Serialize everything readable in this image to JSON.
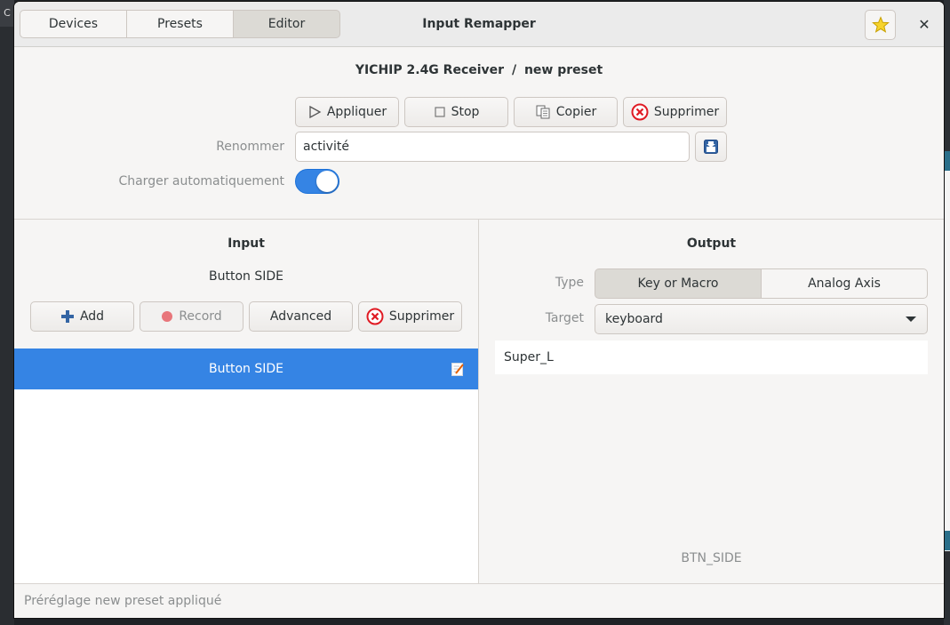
{
  "header": {
    "title": "Input Remapper",
    "views": [
      "Devices",
      "Presets",
      "Editor"
    ],
    "active_view": "Editor",
    "star_icon": "star-icon",
    "close_label": "✕"
  },
  "editor": {
    "device_name": "YICHIP 2.4G Receiver",
    "separator": "/",
    "preset_name": "new preset",
    "buttons": {
      "apply": "Appliquer",
      "stop": "Stop",
      "copy": "Copier",
      "delete": "Supprimer"
    },
    "rename_label": "Renommer",
    "rename_value": "activité",
    "autoload_label": "Charger automatiquement",
    "autoload_on": true
  },
  "input_pane": {
    "heading": "Input",
    "selected_input": "Button SIDE",
    "buttons": {
      "add": "Add",
      "record": "Record",
      "advanced": "Advanced",
      "delete": "Supprimer"
    },
    "mappings": [
      {
        "label": "Button SIDE",
        "selected": true
      }
    ]
  },
  "output_pane": {
    "heading": "Output",
    "type_label": "Type",
    "type_options": [
      "Key or Macro",
      "Analog Axis"
    ],
    "type_selected": "Key or Macro",
    "target_label": "Target",
    "target_value": "keyboard",
    "output_value": "Super_L",
    "event_name": "BTN_SIDE"
  },
  "status": {
    "message": "Préréglage new preset appliqué"
  },
  "colors": {
    "accent": "#3584e4",
    "danger": "#e01b24",
    "star": "#f6d32d"
  }
}
